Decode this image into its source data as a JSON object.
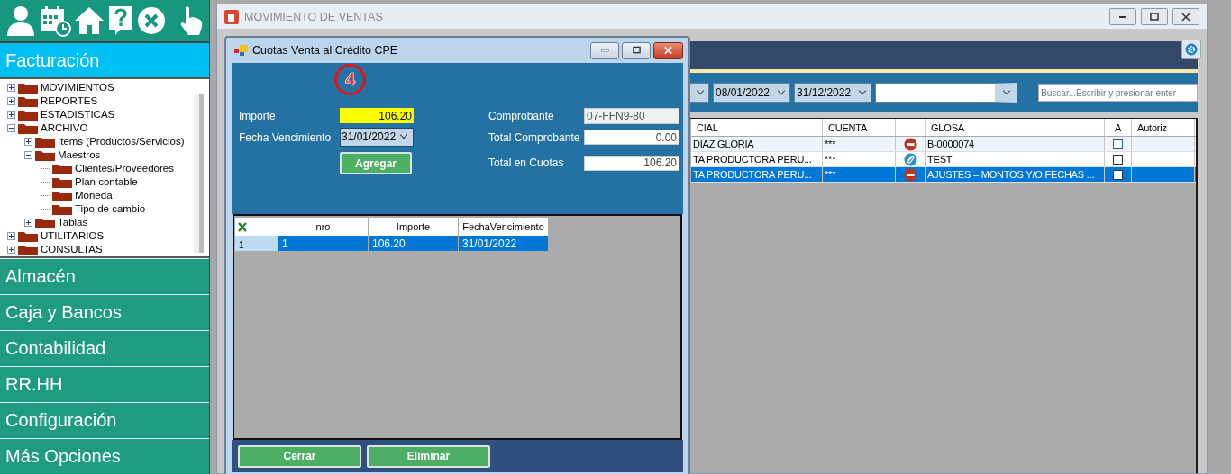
{
  "sidebar": {
    "active_module": "Facturación",
    "tree": [
      {
        "label": "MOVIMIENTOS",
        "expanded": false
      },
      {
        "label": "REPORTES",
        "expanded": false
      },
      {
        "label": "ESTADISTICAS",
        "expanded": false
      },
      {
        "label": "ARCHIVO",
        "expanded": true,
        "children": [
          {
            "label": "Items (Productos/Servicios)",
            "expanded": false
          },
          {
            "label": "Maestros",
            "expanded": true,
            "children": [
              {
                "label": "Clientes/Proveedores"
              },
              {
                "label": "Plan contable"
              },
              {
                "label": "Moneda"
              },
              {
                "label": "Tipo de cambio"
              }
            ]
          },
          {
            "label": "Tablas",
            "expanded": false
          }
        ]
      },
      {
        "label": "UTILITARIOS",
        "expanded": false
      },
      {
        "label": "CONSULTAS",
        "expanded": false
      }
    ],
    "modules": [
      "Almacén",
      "Caja y Bancos",
      "Contabilidad",
      "RR.HH",
      "Configuración",
      "Más Opciones"
    ]
  },
  "main_window": {
    "title": "MOVIMIENTO DE VENTAS",
    "date_from": "08/01/2022",
    "date_to": "31/12/2022",
    "search": {
      "placeholder": "Buscar...Escribir y presionar enter"
    },
    "table": {
      "columns": [
        {
          "kind": "text",
          "label": "CIAL"
        },
        {
          "kind": "text",
          "label": "CUENTA"
        },
        {
          "kind": "icon"
        },
        {
          "kind": "text",
          "label": "GLOSA"
        },
        {
          "kind": "check",
          "label": "A"
        },
        {
          "kind": "text",
          "label": "Autoriz"
        }
      ],
      "rows": [
        {
          "cells": [
            "DIAZ GLORIA",
            "***",
            "B-0000074"
          ],
          "kind": "minus",
          "checked": false,
          "selected": false
        },
        {
          "cells": [
            "TA PRODUCTORA PERU...",
            "***",
            "TEST"
          ],
          "kind": "clip",
          "checked": false,
          "selected": false
        },
        {
          "cells": [
            "TA PRODUCTORA PERU...",
            "***",
            "AJUSTES – MONTOS Y/O FECHAS ..."
          ],
          "kind": "minus",
          "checked": false,
          "selected": true
        }
      ]
    }
  },
  "dialog": {
    "title": "Cuotas Venta al Crédito CPE",
    "annotation": "4",
    "left_fields": [
      {
        "label": "Importe",
        "value": "106.20",
        "kind": "input",
        "focused": true
      },
      {
        "label": "Fecha Vencimiento",
        "value": "31/01/2022",
        "kind": "date",
        "focused": false
      }
    ],
    "add_button": "Agregar",
    "right_fields": [
      {
        "label": "Comprobante",
        "value": "07-FFN9-80",
        "disabled": true
      },
      {
        "label": "Total Comprobante",
        "value": "0.00",
        "disabled": false
      },
      {
        "label": "Total en Cuotas",
        "value": "106.20",
        "disabled": false
      }
    ],
    "grid": {
      "columns": [
        "nro",
        "Importe",
        "FechaVencimiento"
      ],
      "rows": [
        {
          "header": "1",
          "cells": [
            "1",
            "106.20",
            "31/01/2022"
          ],
          "selected": true
        }
      ]
    },
    "buttons": [
      "Cerrar",
      "Eliminar"
    ]
  }
}
